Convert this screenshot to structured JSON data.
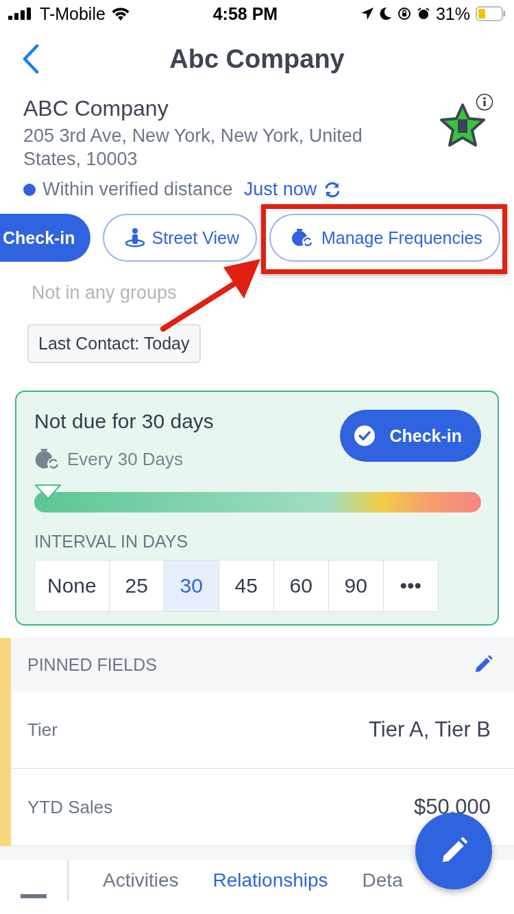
{
  "status_bar": {
    "carrier": "T-Mobile",
    "time": "4:58 PM",
    "battery": "31%"
  },
  "nav": {
    "title": "Abc Company"
  },
  "company": {
    "name": "ABC Company",
    "address": "205 3rd Ave, New York, New York, United States, 10003"
  },
  "location": {
    "status": "Within verified distance",
    "time": "Just now"
  },
  "actions": [
    {
      "kind": "primary",
      "label": "Check-in"
    },
    {
      "kind": "street",
      "label": "Street View"
    },
    {
      "kind": "frequency",
      "label": "Manage Frequencies"
    }
  ],
  "groups": "Not in any groups",
  "last_contact": "Last Contact: Today",
  "frequency_card": {
    "title": "Not due for 30 days",
    "every": "Every 30 Days",
    "button": "Check-in",
    "level": 0.03,
    "interval_label": "INTERVAL IN DAYS",
    "options": [
      {
        "label": "None",
        "selected": false
      },
      {
        "label": "25",
        "selected": false
      },
      {
        "label": "30",
        "selected": true
      },
      {
        "label": "45",
        "selected": false
      },
      {
        "label": "60",
        "selected": false
      },
      {
        "label": "90",
        "selected": false
      },
      {
        "label": "•••",
        "selected": false
      }
    ]
  },
  "pinned_fields": {
    "title": "PINNED FIELDS",
    "rows": [
      {
        "label": "Tier",
        "value": "Tier A, Tier B"
      },
      {
        "label": "YTD Sales",
        "value": "$50,000"
      }
    ]
  },
  "bottom_tabs": [
    {
      "label": "Activities",
      "selected": false
    },
    {
      "label": "Relationships",
      "selected": true
    },
    {
      "label": "Deta",
      "selected": false
    }
  ]
}
